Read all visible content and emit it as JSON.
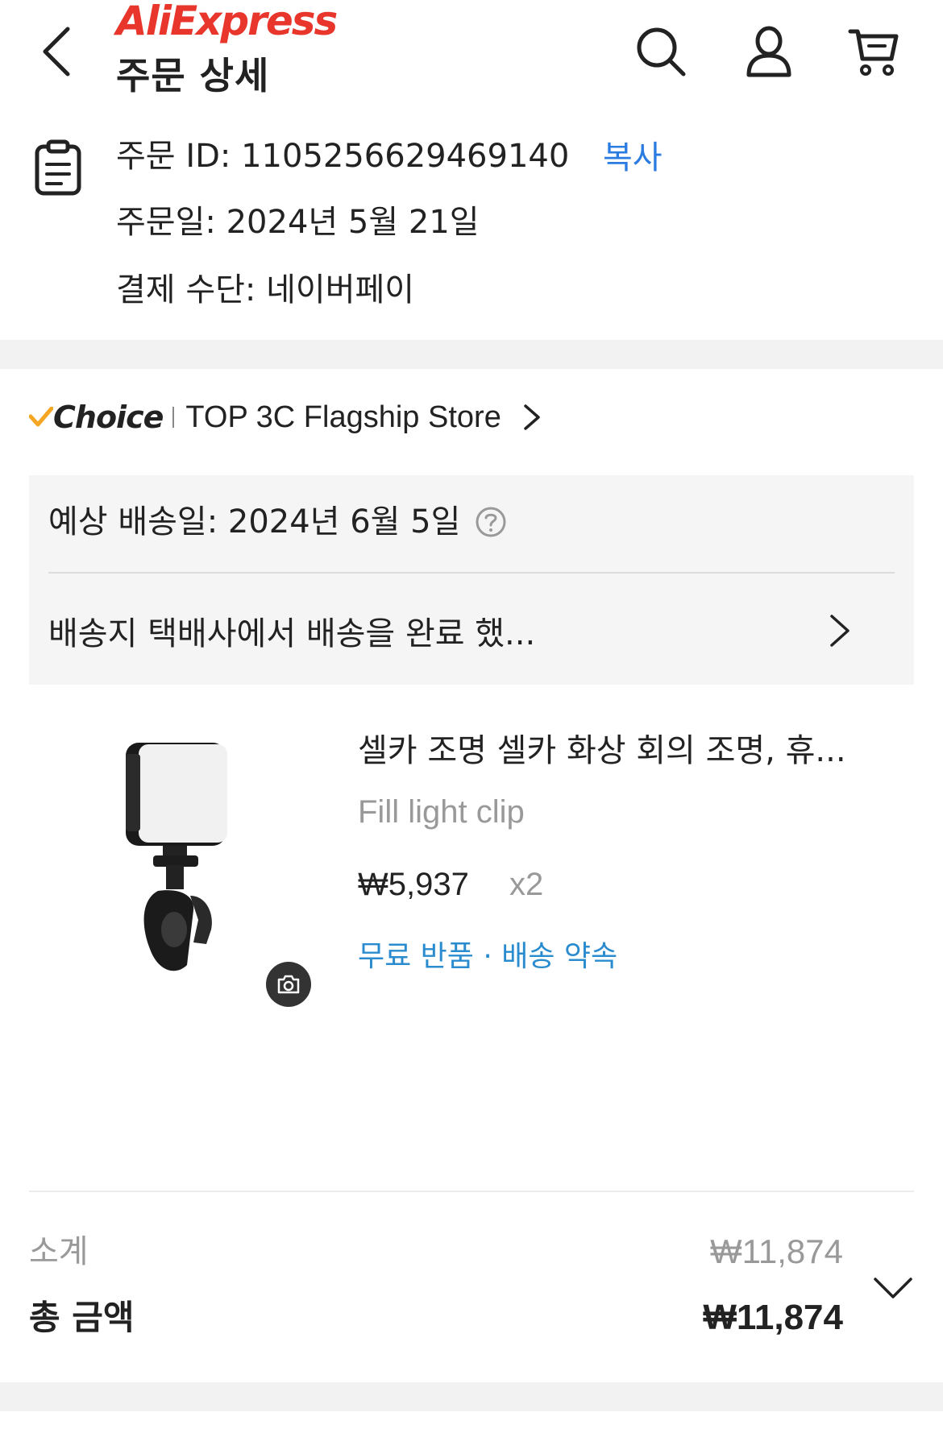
{
  "header": {
    "logo_text": "AliExpress",
    "title": "주문 상세"
  },
  "order": {
    "id_label": "주문 ID: 1105256629469140",
    "copy_label": "복사",
    "date_label": "주문일: 2024년 5월 21일",
    "payment_label": "결제 수단: 네이버페이"
  },
  "store": {
    "badge": "Choice",
    "name": "TOP 3C Flagship Store"
  },
  "delivery": {
    "eta": "예상 배송일: 2024년 6월 5일",
    "status": "배송지 택배사에서 배송을 완료 했..."
  },
  "product": {
    "title": "셀카 조명 셀카 화상 회의 조명, 휴...",
    "variant": "Fill light clip",
    "price": "₩5,937",
    "qty": "x2",
    "promise": "무료 반품 · 배송 약속"
  },
  "summary": {
    "subtotal_label": "소계",
    "subtotal_value": "₩11,874",
    "total_label": "총 금액",
    "total_value": "₩11,874"
  },
  "colors": {
    "brand": "#e8362c",
    "link": "#2a7ce0",
    "promise": "#2a8ccf",
    "choice_check": "#f5a623"
  }
}
